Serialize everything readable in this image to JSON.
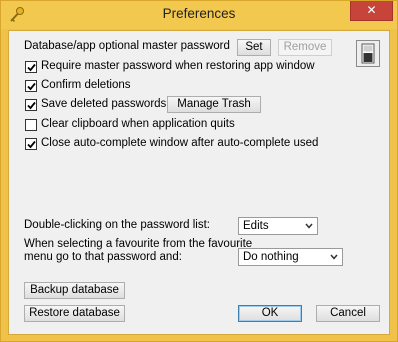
{
  "window": {
    "title": "Preferences",
    "close_glyph": "✕"
  },
  "master_password": {
    "label": "Database/app optional master password",
    "set_label": "Set",
    "remove_label": "Remove"
  },
  "options": [
    {
      "label": "Require master password when restoring app window",
      "checked": true
    },
    {
      "label": "Confirm deletions",
      "checked": true
    },
    {
      "label": "Save deleted passwords",
      "checked": true
    },
    {
      "label": "Clear clipboard when application quits",
      "checked": false
    },
    {
      "label": "Close auto-complete window after auto-complete used",
      "checked": true
    }
  ],
  "manage_trash_label": "Manage Trash",
  "double_click": {
    "label": "Double-clicking on the password list:",
    "value": "Edits"
  },
  "favourite": {
    "label_line1": "When selecting a favourite from the favourite",
    "label_line2": "menu go to that password and:",
    "value": "Do nothing"
  },
  "buttons": {
    "backup": "Backup database",
    "restore": "Restore database",
    "ok": "OK",
    "cancel": "Cancel"
  },
  "icons": [
    "key-icon",
    "close-icon",
    "lock-switch-icon",
    "checkmark-icon",
    "chevron-down-icon"
  ]
}
